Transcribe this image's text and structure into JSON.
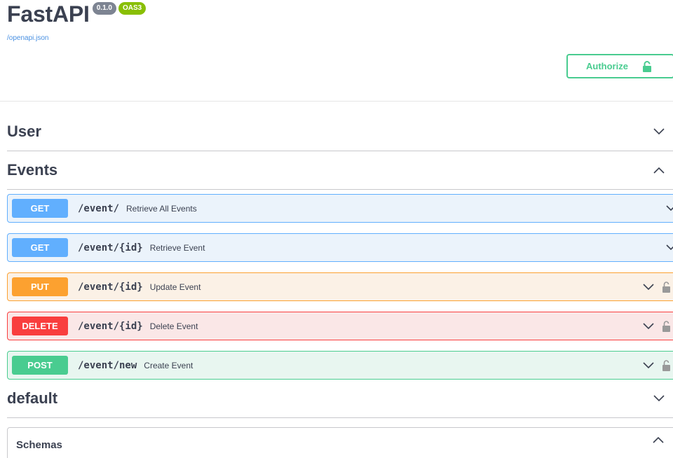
{
  "info": {
    "title": "FastAPI",
    "version": "0.1.0",
    "oas_badge": "OAS3",
    "spec_link": "/openapi.json"
  },
  "authorize": {
    "label": "Authorize",
    "icon": "lock-closed-icon"
  },
  "tags": [
    {
      "name": "User",
      "expanded": false
    },
    {
      "name": "Events",
      "expanded": true
    },
    {
      "name": "default",
      "expanded": false
    }
  ],
  "operations": [
    {
      "method": "GET",
      "path": "/event/",
      "summary": "Retrieve All Events",
      "locked": false
    },
    {
      "method": "GET",
      "path": "/event/{id}",
      "summary": "Retrieve Event",
      "locked": false
    },
    {
      "method": "PUT",
      "path": "/event/{id}",
      "summary": "Update Event",
      "locked": true
    },
    {
      "method": "DELETE",
      "path": "/event/{id}",
      "summary": "Delete Event",
      "locked": true
    },
    {
      "method": "POST",
      "path": "/event/new",
      "summary": "Create Event",
      "locked": true
    }
  ],
  "schemas": {
    "label": "Schemas",
    "expanded": true
  },
  "colors": {
    "get": "#61affe",
    "put": "#fca130",
    "delete": "#f93e3e",
    "post": "#49cc90",
    "link": "#4990e2",
    "text": "#3b4151"
  }
}
